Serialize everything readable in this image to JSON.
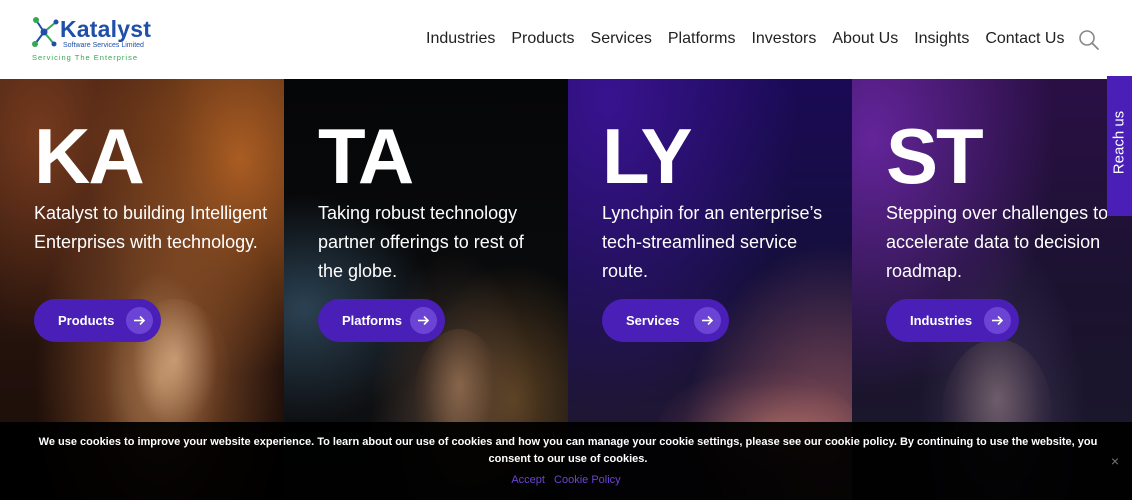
{
  "brand": {
    "name": "Katalyst",
    "subtitle": "Software Services Limited",
    "tagline": "Servicing The Enterprise"
  },
  "nav": {
    "items": [
      {
        "label": "Industries"
      },
      {
        "label": "Products"
      },
      {
        "label": "Services"
      },
      {
        "label": "Platforms"
      },
      {
        "label": "Investors"
      },
      {
        "label": "About Us"
      },
      {
        "label": "Insights"
      },
      {
        "label": "Contact Us"
      }
    ],
    "search_icon": "search-icon"
  },
  "hero": {
    "panels": [
      {
        "letters": "KA",
        "text": "Katalyst to building Intelligent Enterprises with technology.",
        "button": "Products"
      },
      {
        "letters": "TA",
        "text": "Taking robust technology partner offerings to rest of the globe.",
        "button": "Platforms"
      },
      {
        "letters": "LY",
        "text": "Lynchpin for an enterprise’s tech-streamlined service route.",
        "button": "Services"
      },
      {
        "letters": "ST",
        "text": "Stepping over challenges to accelerate data to decision roadmap.",
        "button": "Industries"
      }
    ]
  },
  "reach_us": "Reach us",
  "cookie": {
    "text": "We use cookies to improve your website experience. To learn about our use of cookies and how you can manage your cookie settings, please see our cookie policy. By continuing to use the website, you consent to our use of cookies.",
    "accept": "Accept",
    "policy": "Cookie Policy",
    "close": "×"
  },
  "colors": {
    "accent": "#4a1fb8",
    "brand_blue": "#1f4fa8",
    "brand_green": "#34a853"
  }
}
